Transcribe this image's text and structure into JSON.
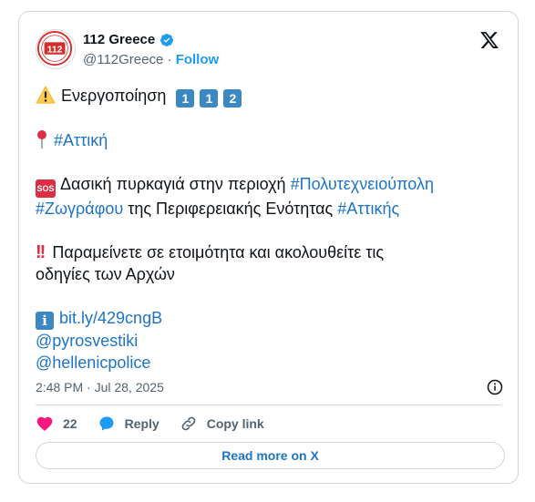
{
  "author": {
    "name": "112 Greece",
    "handle": "@112Greece",
    "separator": "·",
    "follow_label": "Follow",
    "avatar_text": "112"
  },
  "tweet": {
    "line1_text": "Ενεργοποίηση",
    "digits": [
      "1",
      "1",
      "2"
    ],
    "hashtag_attica": "#Αττική",
    "sos_label": "SOS",
    "fire_text_1": "Δασική πυρκαγιά στην περιοχή",
    "hashtag_polytechneioupoli": "#Πολυτεχνειούπολη",
    "hashtag_zografou": "#Ζωγράφου",
    "fire_text_2": "της Περιφερειακής Ενότητας",
    "hashtag_attikis": "#Αττικής",
    "bang": "!!",
    "alert_line_1": "Παραμείνετε σε ετοιμότητα και ακολουθείτε τις",
    "alert_line_2": "οδηγίες των Αρχών",
    "info_letter": "i",
    "link_url": "bit.ly/429cngB",
    "mention_1": "@pyrosvestiki",
    "mention_2": "@hellenicpolice"
  },
  "meta": {
    "timestamp": "2:48 PM · Jul 28, 2025"
  },
  "actions": {
    "likes": "22",
    "reply_label": "Reply",
    "copy_label": "Copy link"
  },
  "read_more_label": "Read more on X",
  "colors": {
    "accent": "#1d9bf0",
    "link": "#1d74c4",
    "like": "#f91880",
    "keycap": "#3b88c3",
    "sos": "#dd2e44"
  }
}
